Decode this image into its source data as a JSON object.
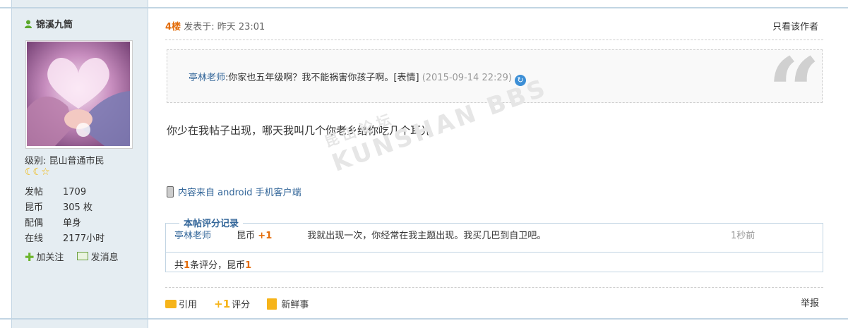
{
  "user": {
    "name": "锦溪九筒",
    "level_label": "级别: 昆山普通市民",
    "stars": "☾☾☆",
    "stats": [
      {
        "key": "发帖",
        "value": "1709"
      },
      {
        "key": "昆币",
        "value": "305 枚"
      },
      {
        "key": "配偶",
        "value": "单身"
      },
      {
        "key": "在线",
        "value": "2177小时"
      }
    ],
    "follow_label": "加关注",
    "message_label": "发消息"
  },
  "post": {
    "floor": "4楼",
    "posted_at": "发表于: 昨天 23:01",
    "only_author": "只看该作者",
    "quote": {
      "author": "亭林老师",
      "text": ":你家也五年级啊？我不能祸害你孩子啊。[表情]",
      "time": "(2015-09-14 22:29)"
    },
    "message": "你少在我帖子出现，哪天我叫几个你老乡给你吃几个耳光",
    "client_note": "内容来自 android 手机客户端",
    "watermark_cn": "昆山论坛",
    "watermark_en": "KUNSHAN BBS"
  },
  "rating": {
    "title": "本帖评分记录",
    "rows": [
      {
        "user": "亭林老师",
        "currency": "昆币",
        "score": "+1",
        "reason": "我就出现一次，你经常在我主题出现。我买几巴到自卫吧。",
        "time": "1秒前"
      }
    ],
    "total_prefix": "共",
    "total_count": "1",
    "total_mid": "条评分，昆币",
    "total_value": "1"
  },
  "actions": {
    "quote_label": "引用",
    "rate_label": "评分",
    "fresh_label": "新鲜事",
    "report_label": "举报"
  },
  "colors": {
    "sidebar_bg": "#e5edf2",
    "border": "#c2d5e3",
    "link": "#336699",
    "accent": "#e36c09"
  }
}
